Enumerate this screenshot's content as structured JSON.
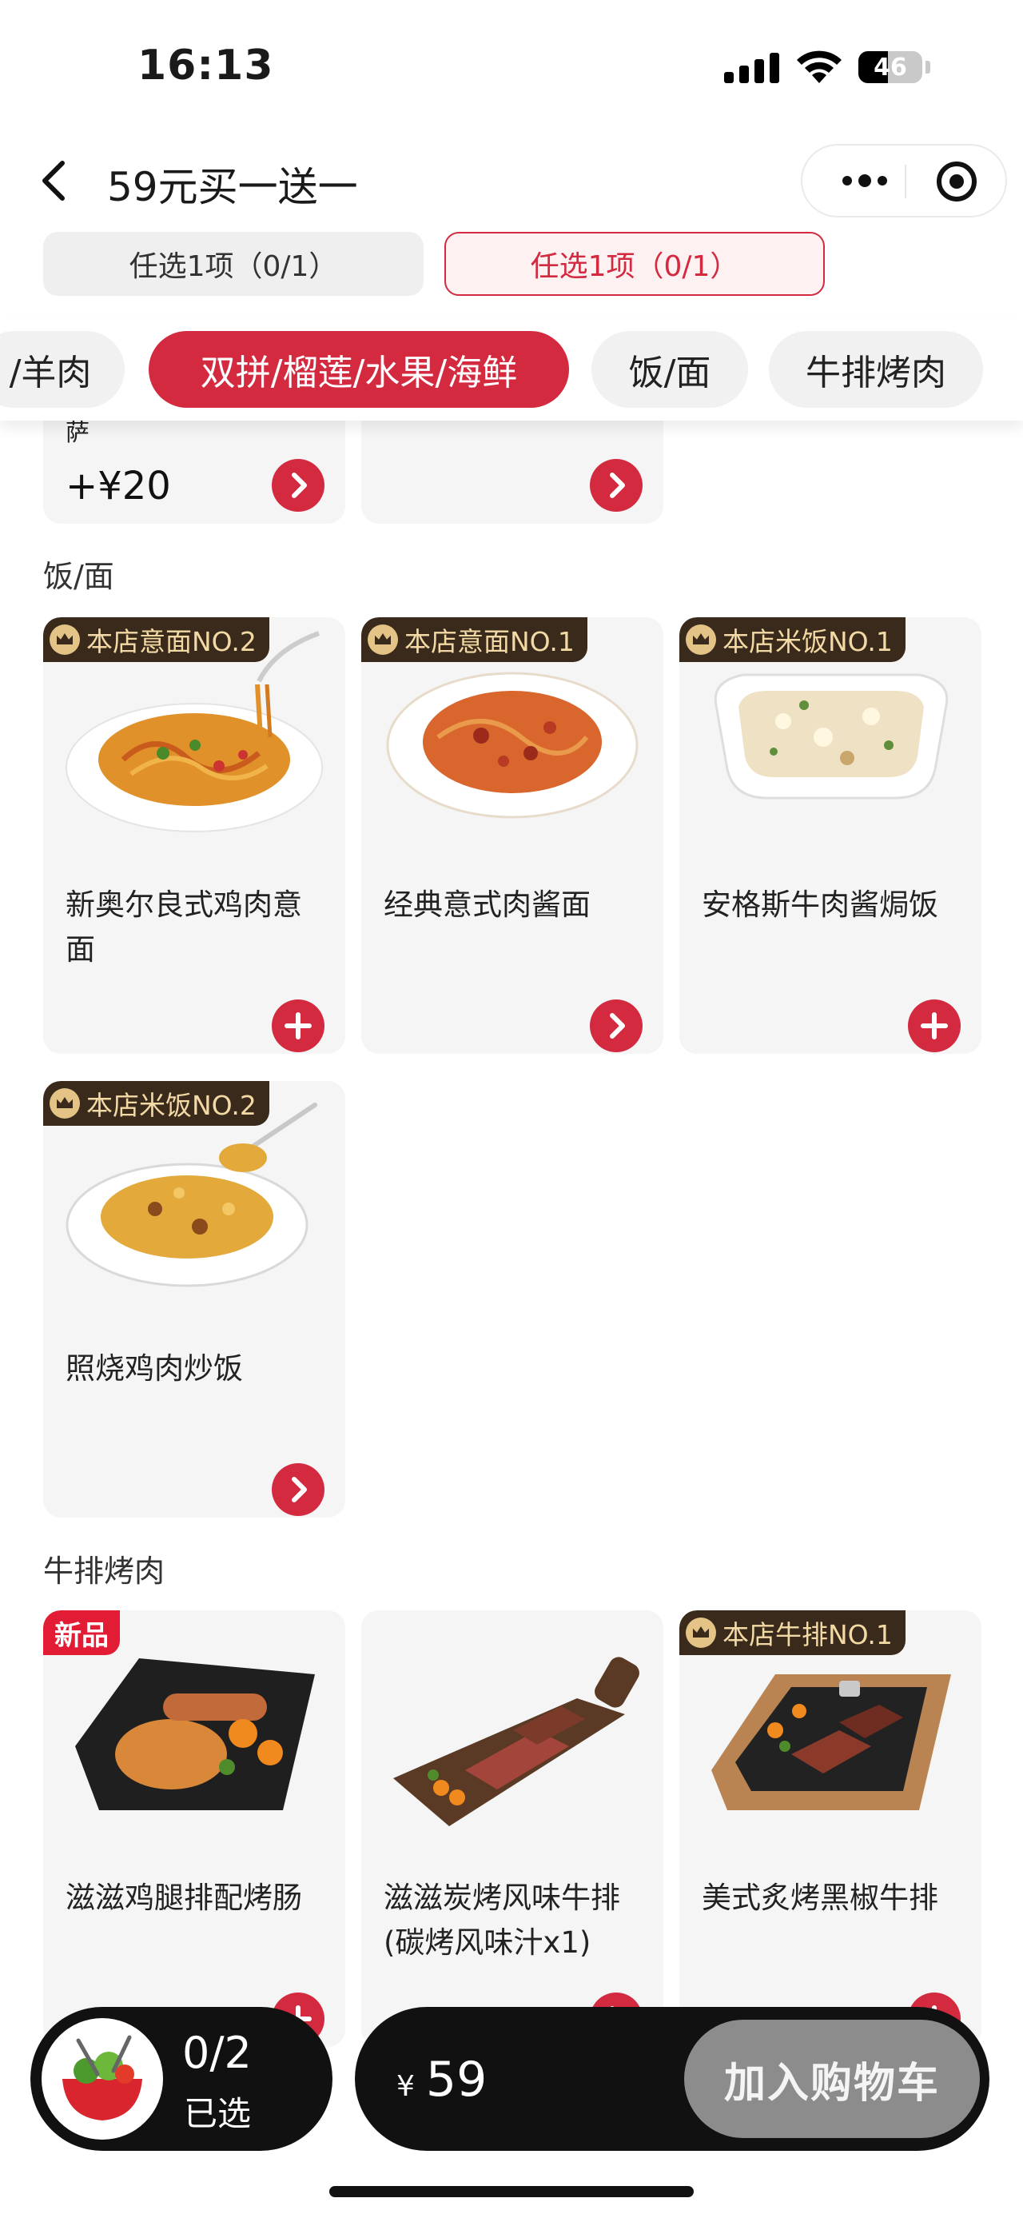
{
  "status_bar": {
    "time": "16:13",
    "battery": "46",
    "battery_level_percent": 46
  },
  "nav": {
    "title": "59元买一送一",
    "back_icon": "chevron-left-icon",
    "more_icon": "more-dots-icon",
    "target_icon": "record-target-icon"
  },
  "choose_tabs": [
    {
      "label": "任选1项（0/1）"
    },
    {
      "label": "任选1项（0/1）"
    }
  ],
  "categories": [
    {
      "label": "/羊肉"
    },
    {
      "label": "双拼/榴莲/水果/海鲜"
    },
    {
      "label": "饭/面"
    },
    {
      "label": "牛排烤肉"
    }
  ],
  "active_category_index": 1,
  "top_partial": {
    "name_fragment": "萨",
    "price": "+¥20"
  },
  "sections": [
    {
      "title": "饭/面",
      "items": [
        {
          "badge": "本店意面NO.2",
          "name": "新奥尔良式鸡肉意面",
          "button": "plus-icon"
        },
        {
          "badge": "本店意面NO.1",
          "name": "经典意式肉酱面",
          "button": "chevron-right-icon"
        },
        {
          "badge": "本店米饭NO.1",
          "name": "安格斯牛肉酱焗饭",
          "button": "plus-icon"
        },
        {
          "badge": "本店米饭NO.2",
          "name": "照烧鸡肉炒饭",
          "button": "chevron-right-icon"
        }
      ]
    },
    {
      "title": "牛排烤肉",
      "items": [
        {
          "badge": "新品",
          "name": "滋滋鸡腿排配烤肠",
          "button": "plus-icon"
        },
        {
          "badge": "",
          "name": "滋滋炭烤风味牛排(碳烤风味汁x1)",
          "button": "chevron-right-icon"
        },
        {
          "badge": "本店牛排NO.1",
          "name": "美式炙烤黑椒牛排",
          "button": "plus-icon"
        }
      ]
    }
  ],
  "bottom_bar": {
    "count": "0/2",
    "count_label": "已选",
    "currency": "¥",
    "price": "59",
    "cart_button": "加入购物车",
    "accent": "#d32a40"
  }
}
